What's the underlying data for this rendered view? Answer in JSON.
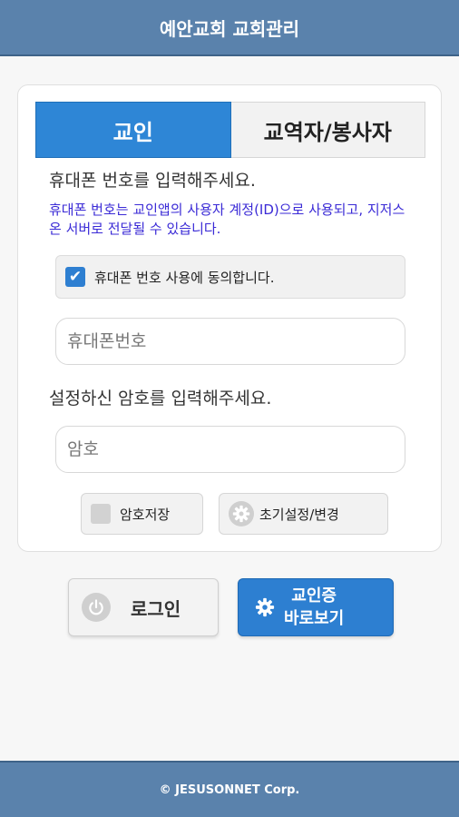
{
  "header": {
    "title": "예안교회 교회관리"
  },
  "tabs": [
    {
      "label": "교인",
      "active": true
    },
    {
      "label": "교역자/봉사자",
      "active": false
    }
  ],
  "phone_prompt": "휴대폰 번호를 입력해주세요.",
  "phone_notice": "휴대폰 번호는 교인앱의 사용자 계정(ID)으로 사용되고, 지저스온 서버로 전달될 수 있습니다.",
  "consent": {
    "label": "휴대폰 번호 사용에 동의합니다.",
    "checked": true
  },
  "phone_input": {
    "placeholder": "휴대폰번호",
    "value": ""
  },
  "password_prompt": "설정하신 암호를 입력해주세요.",
  "password_input": {
    "placeholder": "암호",
    "value": ""
  },
  "save_password": {
    "label": "암호저장",
    "checked": false
  },
  "reset_password": {
    "label": "초기설정/변경",
    "icon": "gear-icon"
  },
  "login_button": {
    "label": "로그인",
    "icon": "power-icon"
  },
  "member_card_button": {
    "line1": "교인증",
    "line2": "바로보기",
    "icon": "gear-icon"
  },
  "footer": {
    "text": "© JESUSONNET Corp."
  },
  "colors": {
    "header": "#5a82ac",
    "accent": "#2e86d6",
    "notice": "#3a2ad6"
  }
}
